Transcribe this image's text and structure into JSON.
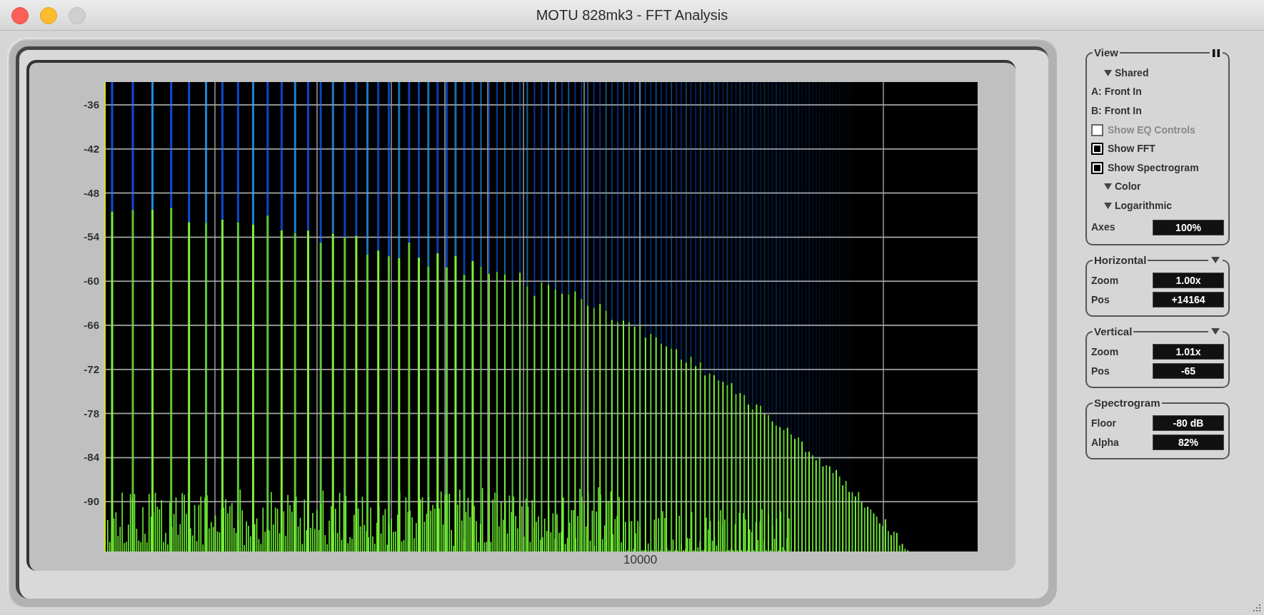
{
  "window": {
    "title": "MOTU 828mk3 - FFT Analysis"
  },
  "plot": {
    "y_ticks": [
      "-36",
      "-42",
      "-48",
      "-54",
      "-60",
      "-66",
      "-72",
      "-78",
      "-84",
      "-90"
    ],
    "x_ticks": [
      "10000"
    ]
  },
  "view": {
    "title": "View",
    "items": [
      {
        "kind": "menu",
        "label": "Shared"
      },
      {
        "kind": "text",
        "label": "A: Front In"
      },
      {
        "kind": "text",
        "label": "B: Front In"
      },
      {
        "kind": "checkbox",
        "label": "Show EQ Controls",
        "checked": false,
        "disabled": true
      },
      {
        "kind": "checkbox",
        "label": "Show FFT",
        "checked": true,
        "disabled": false
      },
      {
        "kind": "checkbox",
        "label": "Show Spectrogram",
        "checked": true,
        "disabled": false
      },
      {
        "kind": "menu",
        "label": "Color"
      },
      {
        "kind": "menu",
        "label": "Logarithmic"
      },
      {
        "kind": "field",
        "label": "Axes",
        "value": "100%"
      }
    ]
  },
  "panels": [
    {
      "title": "Horizontal",
      "menu": true,
      "fields": [
        {
          "label": "Zoom",
          "value": "1.00x"
        },
        {
          "label": "Pos",
          "value": "+14164"
        }
      ]
    },
    {
      "title": "Vertical",
      "menu": true,
      "fields": [
        {
          "label": "Zoom",
          "value": "1.01x"
        },
        {
          "label": "Pos",
          "value": "-65"
        }
      ]
    },
    {
      "title": "Spectrogram",
      "menu": false,
      "fields": [
        {
          "label": "Floor",
          "value": "-80 dB"
        },
        {
          "label": "Alpha",
          "value": "82%"
        }
      ]
    }
  ]
}
